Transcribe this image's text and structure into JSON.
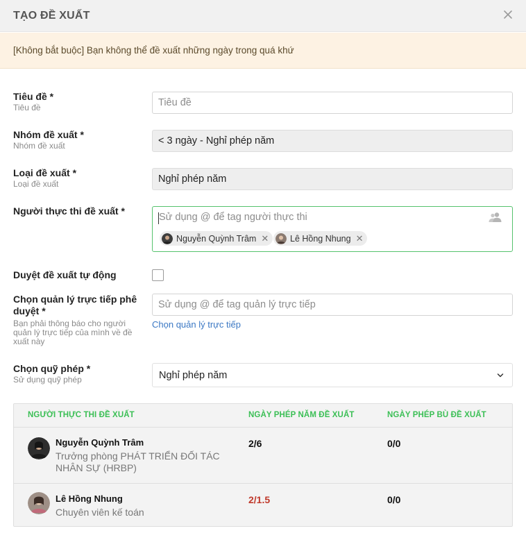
{
  "dialog": {
    "title": "TẠO ĐỀ XUẤT",
    "notice": "[Không bắt buộc] Bạn không thể đề xuất những ngày trong quá khứ"
  },
  "form": {
    "title_field": {
      "label": "Tiêu đề *",
      "sublabel": "Tiêu đề",
      "placeholder": "Tiêu đề",
      "value": ""
    },
    "group_field": {
      "label": "Nhóm đề xuất *",
      "sublabel": "Nhóm đề xuất",
      "value": "< 3 ngày - Nghỉ phép năm"
    },
    "type_field": {
      "label": "Loại đề xuất *",
      "sublabel": "Loại đề xuất",
      "value": "Nghỉ phép năm"
    },
    "assignee_field": {
      "label": "Người thực thi đề xuất *",
      "placeholder": "Sử dụng @ để tag người thực thi",
      "tags": [
        {
          "name": "Nguyễn Quỳnh Trâm"
        },
        {
          "name": "Lê Hồng Nhung"
        }
      ]
    },
    "auto_approve": {
      "label": "Duyệt đề xuất tự động",
      "checked": false
    },
    "manager_field": {
      "label": "Chọn quản lý trực tiếp phê duyệt *",
      "sublabel": "Bạn phải thông báo cho người quản lý trực tiếp của mình về đề xuất này",
      "placeholder": "Sử dụng @ để tag quản lý trực tiếp",
      "link": "Chọn quản lý trực tiếp"
    },
    "leave_fund": {
      "label": "Chọn quỹ phép *",
      "sublabel": "Sử dụng quỹ phép",
      "value": "Nghỉ phép năm"
    }
  },
  "table": {
    "headers": [
      "NGƯỜI THỰC THI ĐỀ XUẤT",
      "NGÀY PHÉP NĂM ĐỀ XUẤT",
      "NGÀY PHÉP BÙ ĐỀ XUẤT"
    ],
    "rows": [
      {
        "name": "Nguyễn Quỳnh Trâm",
        "role": "Trưởng phòng PHÁT TRIỂN ĐỐI TÁC NHÂN SỰ (HRBP)",
        "annual": "2/6",
        "annual_exceeded": false,
        "comp": "0/0"
      },
      {
        "name": "Lê Hồng Nhung",
        "role": "Chuyên viên kế toán",
        "annual": "2/1.5",
        "annual_exceeded": true,
        "comp": "0/0"
      }
    ]
  },
  "colors": {
    "accent_green": "#3bbf55",
    "warning_red": "#c0392b",
    "link_blue": "#3b78c4",
    "notice_bg": "#fdf2e3"
  },
  "icons": [
    "close-icon",
    "users-icon",
    "remove-tag-icon",
    "chevron-down-icon"
  ]
}
